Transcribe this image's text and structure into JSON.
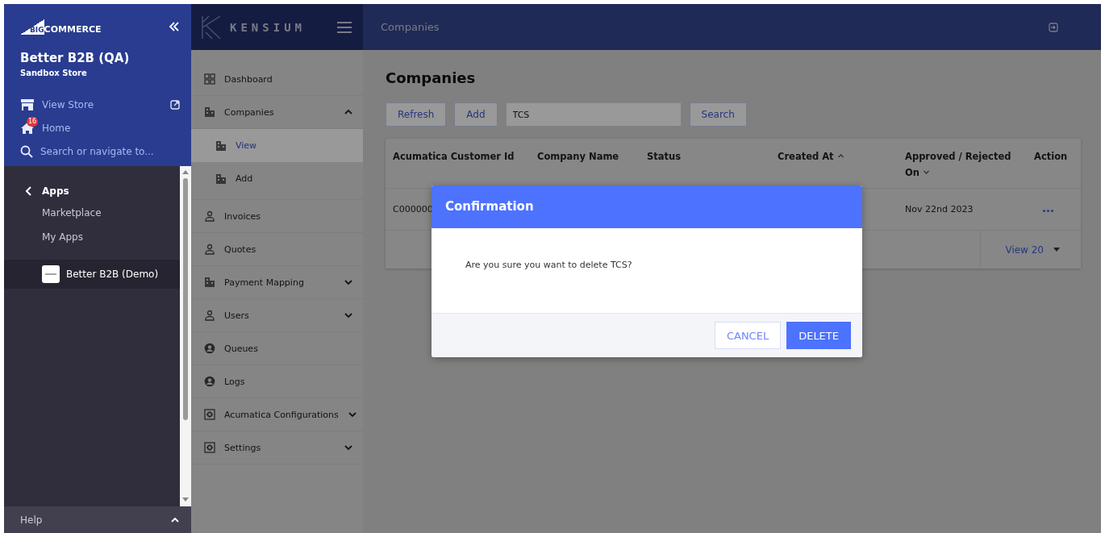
{
  "store_sidebar": {
    "logo": {
      "mark": "BIG",
      "word": "COMMERCE"
    },
    "store_name": "Better B2B (QA)",
    "store_type": "Sandbox Store",
    "links": [
      {
        "kind": "view-store",
        "label": "View Store"
      },
      {
        "kind": "home",
        "label": "Home",
        "badge": "16"
      },
      {
        "kind": "search",
        "placeholder": "Search or navigate to..."
      }
    ],
    "section": {
      "title": "Apps",
      "items": [
        {
          "label": "Marketplace"
        },
        {
          "label": "My Apps"
        }
      ]
    },
    "apps": [
      {
        "label": "Better B2B (Demo)",
        "selected": true
      }
    ],
    "footer": {
      "label": "Help"
    }
  },
  "app": {
    "logo": "KENSIUM",
    "header_title": "Companies",
    "nav": [
      {
        "label": "Dashboard",
        "kind": "grid",
        "selected": false
      },
      {
        "label": "Companies",
        "kind": "building",
        "selected": false,
        "expanded": true,
        "children": [
          {
            "label": "View",
            "kind": "building",
            "selected": true
          },
          {
            "label": "Add",
            "kind": "building",
            "selected": false
          }
        ]
      },
      {
        "label": "Invoices",
        "kind": "person",
        "selected": false
      },
      {
        "label": "Quotes",
        "kind": "person",
        "selected": false
      },
      {
        "label": "Payment Mapping",
        "kind": "building",
        "selected": false,
        "expanded": false
      },
      {
        "label": "Users",
        "kind": "person",
        "selected": false,
        "expanded": false
      },
      {
        "label": "Queues",
        "kind": "account",
        "selected": false
      },
      {
        "label": "Logs",
        "kind": "account",
        "selected": false
      },
      {
        "label": "Acumatica Configurations",
        "kind": "gear",
        "selected": false,
        "expanded": false
      },
      {
        "label": "Settings",
        "kind": "gear",
        "selected": false,
        "expanded": false
      }
    ],
    "page": {
      "title": "Companies",
      "toolbar": [
        {
          "kind": "button",
          "label": "Refresh"
        },
        {
          "kind": "button",
          "label": "Add"
        },
        {
          "kind": "field",
          "value": "TCS"
        },
        {
          "kind": "button",
          "label": "Search"
        }
      ],
      "table": {
        "columns": [
          {
            "label": "Acumatica Customer Id"
          },
          {
            "label": "Company Name"
          },
          {
            "label": "Status"
          },
          {
            "label": "Created At",
            "sorted": true,
            "ascending": true
          },
          {
            "label": "Approved / Rejected On",
            "sorted": true,
            "ascending": false
          },
          {
            "label": "Action"
          }
        ],
        "rows": [
          [
            "C000000",
            "",
            "",
            "",
            "Nov 22nd 2023",
            ""
          ]
        ],
        "page_size": "View 20"
      }
    },
    "dialog": {
      "title": "Confirmation",
      "message": "Are you sure you want to delete TCS?",
      "buttons": [
        {
          "kind": "secondary",
          "label": "CANCEL"
        },
        {
          "kind": "primary",
          "label": "DELETE"
        }
      ]
    }
  }
}
